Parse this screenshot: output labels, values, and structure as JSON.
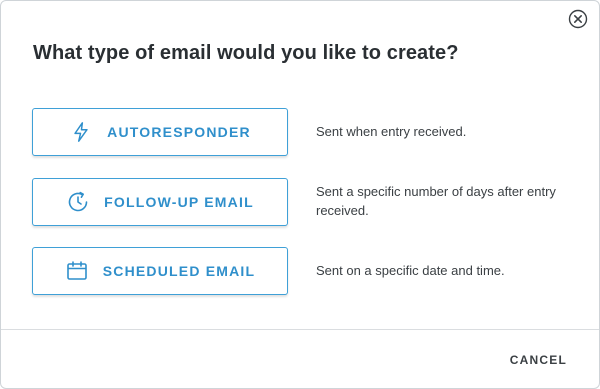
{
  "dialog": {
    "title": "What type of email would you like to create?",
    "close_icon": "close-circle-icon",
    "options": [
      {
        "label": "AUTORESPONDER",
        "icon": "lightning-bolt-icon",
        "description": "Sent when entry received."
      },
      {
        "label": "FOLLOW-UP EMAIL",
        "icon": "clock-arrow-icon",
        "description": "Sent a specific number of days after entry received."
      },
      {
        "label": "SCHEDULED EMAIL",
        "icon": "calendar-icon",
        "description": "Sent on a specific date and time."
      }
    ],
    "cancel_label": "CANCEL"
  },
  "colors": {
    "accent": "#2f8fcb",
    "button_border": "#3fa0d7",
    "title_text": "#2a2f33",
    "body_text": "#3b4044",
    "divider": "#dadde0"
  }
}
